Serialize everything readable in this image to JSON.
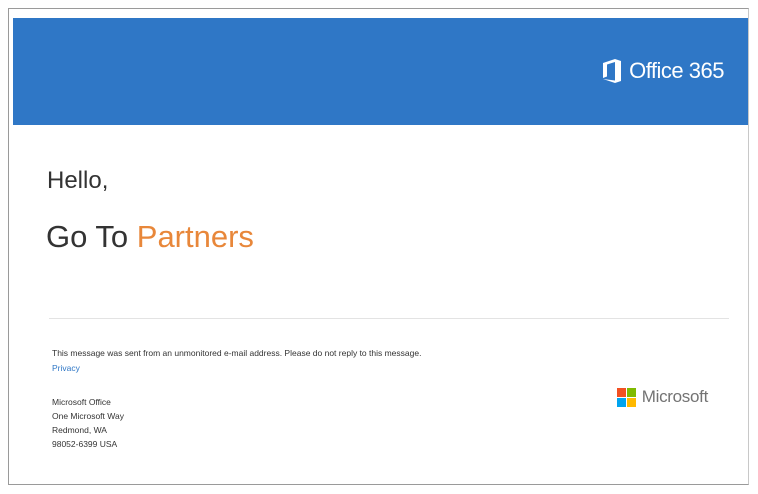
{
  "header": {
    "brand_name": "Office 365",
    "brand_icon": "office-logo-icon",
    "background_color": "#2f77c6"
  },
  "body": {
    "greeting": "Hello,",
    "headline_prefix": "Go To ",
    "headline_accent": "Partners",
    "accent_color": "#e8873a"
  },
  "footer": {
    "notice": "This message was sent from an unmonitored e-mail address. Please do not reply to this message.",
    "privacy_link": "Privacy",
    "address": [
      "Microsoft Office",
      "One Microsoft Way",
      "Redmond, WA",
      "98052-6399 USA"
    ],
    "microsoft_logo_text": "Microsoft",
    "microsoft_logo_colors": [
      "#f25022",
      "#7fba00",
      "#00a4ef",
      "#ffb900"
    ]
  }
}
